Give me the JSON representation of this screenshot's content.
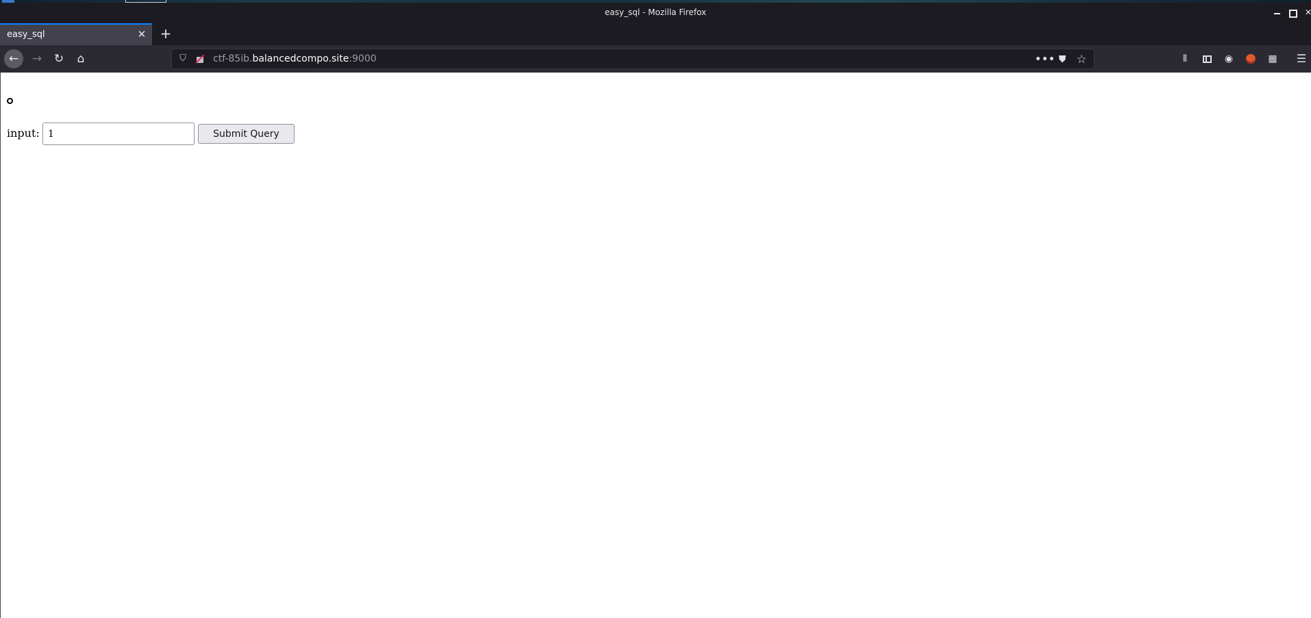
{
  "window": {
    "title": "easy_sql - Mozilla Firefox"
  },
  "tabs": [
    {
      "label": "easy_sql",
      "active": true
    }
  ],
  "toolbar": {
    "url_prefix": "ctf-85ib.",
    "url_host": "balancedcompo.site",
    "url_port": ":9000",
    "more_label": "•••"
  },
  "form": {
    "label": "input:",
    "input_value": "1",
    "submit_label": "Submit Query"
  },
  "colors": {
    "accent": "#0a84ff",
    "titlebar": "#1c1b22",
    "toolbar": "#2b2a33"
  }
}
